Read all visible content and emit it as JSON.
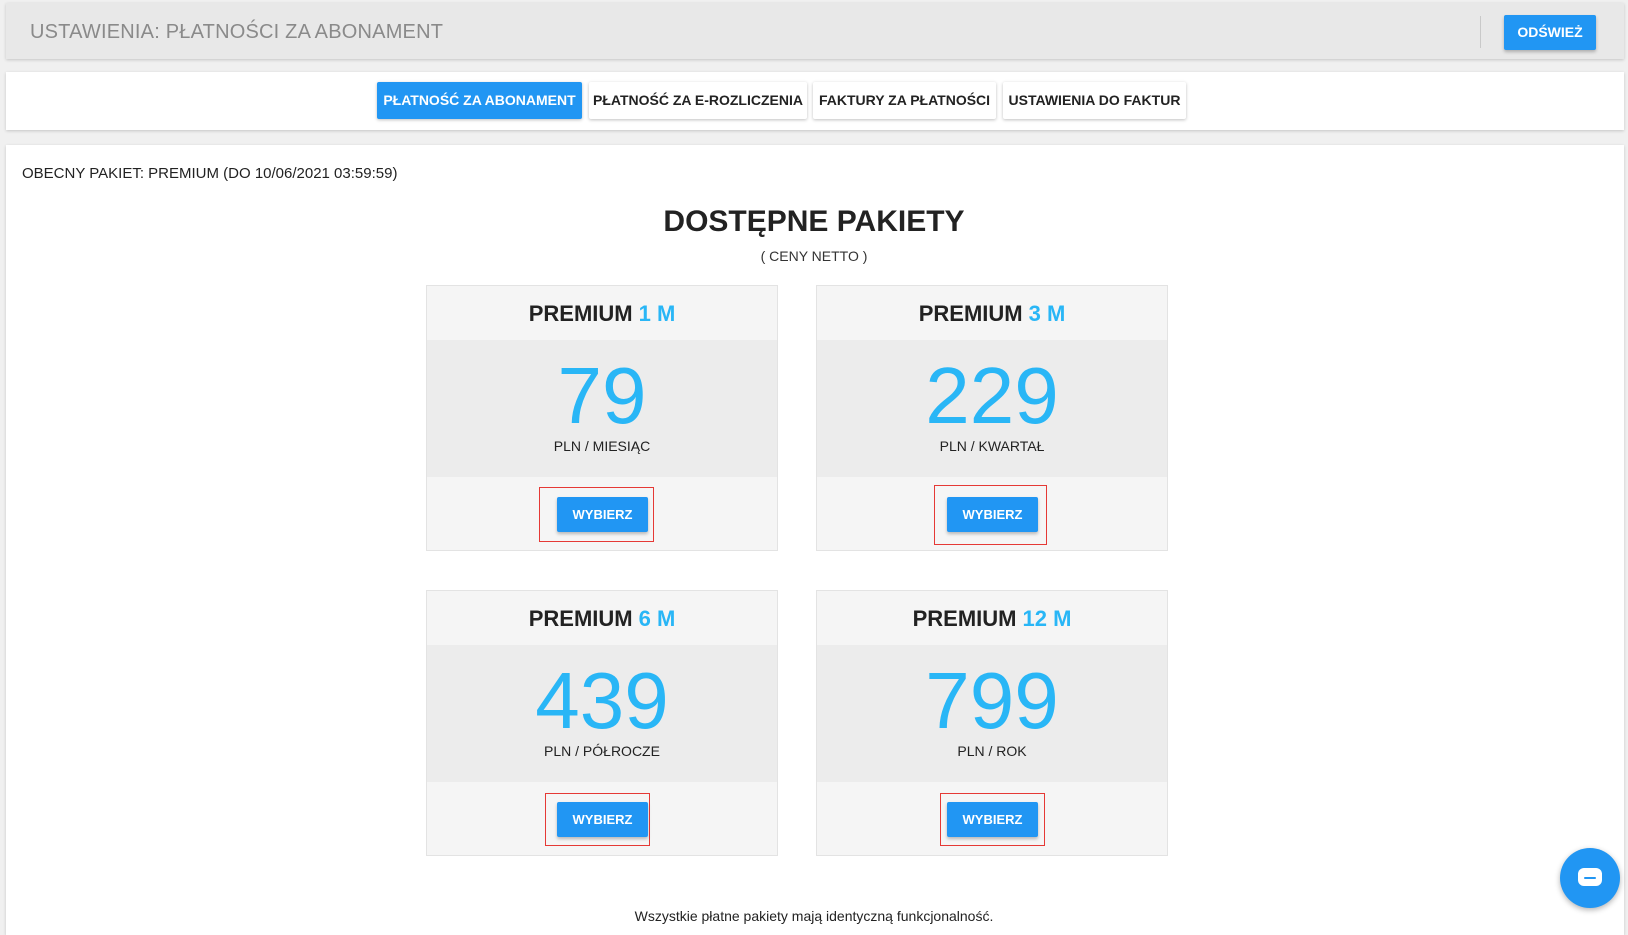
{
  "header": {
    "title": "USTAWIENIA: PŁATNOŚCI ZA ABONAMENT",
    "refresh_label": "ODŚWIEŻ"
  },
  "tabs": [
    {
      "label": "PŁATNOŚĆ ZA ABONAMENT",
      "active": true
    },
    {
      "label": "PŁATNOŚĆ ZA E-ROZLICZENIA",
      "active": false
    },
    {
      "label": "FAKTURY ZA PŁATNOŚCI",
      "active": false
    },
    {
      "label": "USTAWIENIA DO FAKTUR",
      "active": false
    }
  ],
  "main": {
    "current_package": "OBECNY PAKIET: PREMIUM (DO 10/06/2021 03:59:59)",
    "title": "DOSTĘPNE PAKIETY",
    "subtitle": "( CENY NETTO )",
    "footer_note": "Wszystkie płatne pakiety mają identyczną funkcjonalność."
  },
  "packages": [
    {
      "name": "PREMIUM",
      "duration": "1 M",
      "price": "79",
      "unit": "PLN / MIESIĄC",
      "button_label": "WYBIERZ"
    },
    {
      "name": "PREMIUM",
      "duration": "3 M",
      "price": "229",
      "unit": "PLN / KWARTAŁ",
      "button_label": "WYBIERZ"
    },
    {
      "name": "PREMIUM",
      "duration": "6 M",
      "price": "439",
      "unit": "PLN / PÓŁROCZE",
      "button_label": "WYBIERZ"
    },
    {
      "name": "PREMIUM",
      "duration": "12 M",
      "price": "799",
      "unit": "PLN / ROK",
      "button_label": "WYBIERZ"
    }
  ],
  "colors": {
    "accent": "#2196f3",
    "price": "#29b6f6",
    "highlight": "#e53935"
  },
  "icons": {
    "chat": "chat-icon"
  }
}
